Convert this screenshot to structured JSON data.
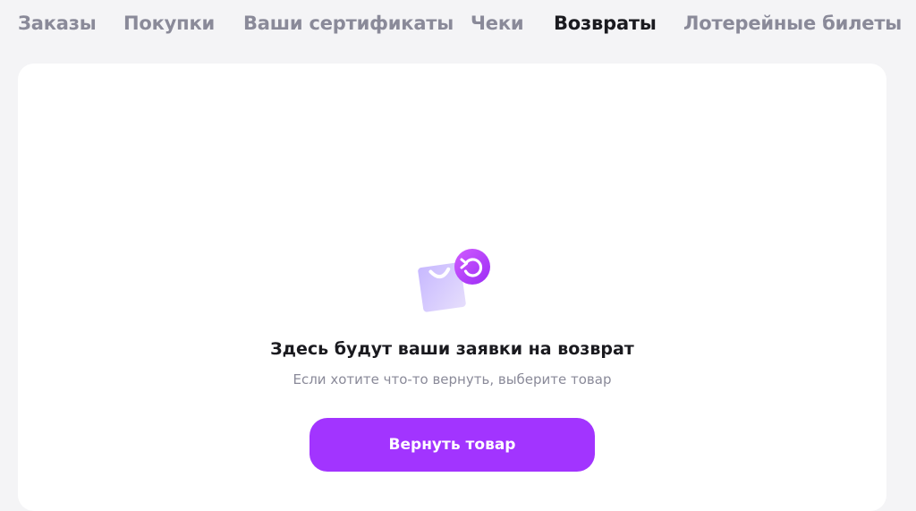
{
  "tabs": [
    {
      "label": "Заказы",
      "active": false
    },
    {
      "label": "Покупки",
      "active": false
    },
    {
      "label": "Ваши сертификаты",
      "active": false
    },
    {
      "label": "Чеки",
      "active": false
    },
    {
      "label": "Возвраты",
      "active": true
    },
    {
      "label": "Лотерейные билеты",
      "active": false
    }
  ],
  "empty_state": {
    "icon": "return-bag-icon",
    "title": "Здесь будут ваши заявки на возврат",
    "subtitle": "Если хотите что-то вернуть, выберите товар",
    "button_label": "Вернуть товар"
  },
  "colors": {
    "accent": "#a234ff",
    "tab_inactive": "#8a8a99",
    "tab_active": "#1a1a1f",
    "background": "#f4f4f6",
    "card": "#ffffff"
  }
}
